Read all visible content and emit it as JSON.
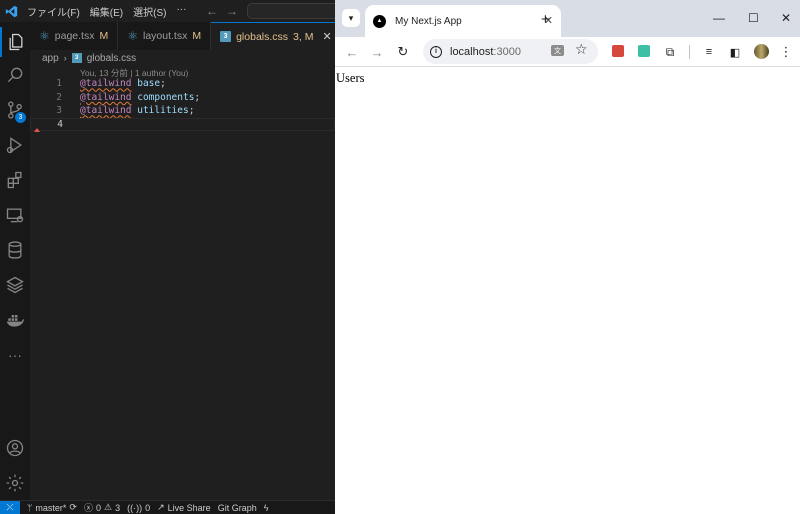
{
  "vscode": {
    "menu": [
      "ファイル(F)",
      "編集(E)",
      "選択(S)",
      "···"
    ],
    "tabs": [
      {
        "label": "page.tsx",
        "status": "M",
        "icon": "react-icon"
      },
      {
        "label": "layout.tsx",
        "status": "M",
        "icon": "react-icon"
      },
      {
        "label": "globals.css",
        "status": "3, M",
        "icon": "css-icon",
        "active": true
      }
    ],
    "breadcrumb": {
      "folder": "app",
      "file": "globals.css"
    },
    "blame": "You, 13 分前 | 1 author (You)",
    "source_control_badge": "3",
    "code_lines": [
      {
        "num": "1",
        "directive": "@tailwind",
        "value": "base",
        "punct": ";"
      },
      {
        "num": "2",
        "directive": "@tailwind",
        "value": "components",
        "punct": ";"
      },
      {
        "num": "3",
        "directive": "@tailwind",
        "value": "utilities",
        "punct": ";"
      },
      {
        "num": "4",
        "directive": "",
        "value": "",
        "punct": ""
      }
    ],
    "status_bar": {
      "branch": "master*",
      "errors": "0",
      "warnings": "3",
      "ports": "0",
      "live_share": "Live Share",
      "git_graph": "Git Graph"
    },
    "colors": {
      "accent": "#0078d4",
      "modified": "#e2c08d",
      "keyword": "#c586c0",
      "value": "#9cdcfe"
    }
  },
  "browser": {
    "tab_title": "My Next.js App",
    "url_host": "localhost",
    "url_port": ":3000",
    "page_heading": "Users",
    "translate_glyph": "文"
  }
}
